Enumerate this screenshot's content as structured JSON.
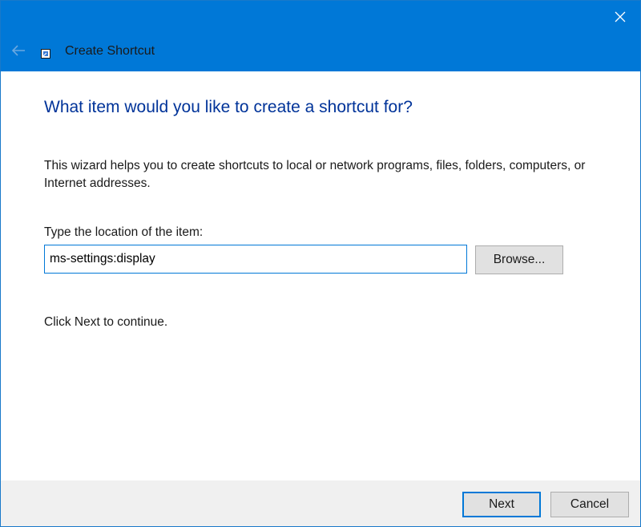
{
  "window": {
    "title": "Create Shortcut"
  },
  "page": {
    "heading": "What item would you like to create a shortcut for?",
    "description": "This wizard helps you to create shortcuts to local or network programs, files, folders, computers, or Internet addresses.",
    "location_label": "Type the location of the item:",
    "location_value": "ms-settings:display",
    "browse_label": "Browse...",
    "continue_text": "Click Next to continue."
  },
  "footer": {
    "next_label": "Next",
    "cancel_label": "Cancel"
  },
  "icons": {
    "close": "close-icon",
    "back": "back-arrow-icon",
    "app": "shortcut-app-icon"
  },
  "colors": {
    "titlebar": "#0078d7",
    "heading": "#003399",
    "footer": "#f0f0f0",
    "button_face": "#e1e1e1",
    "focus_border": "#0078d7"
  }
}
